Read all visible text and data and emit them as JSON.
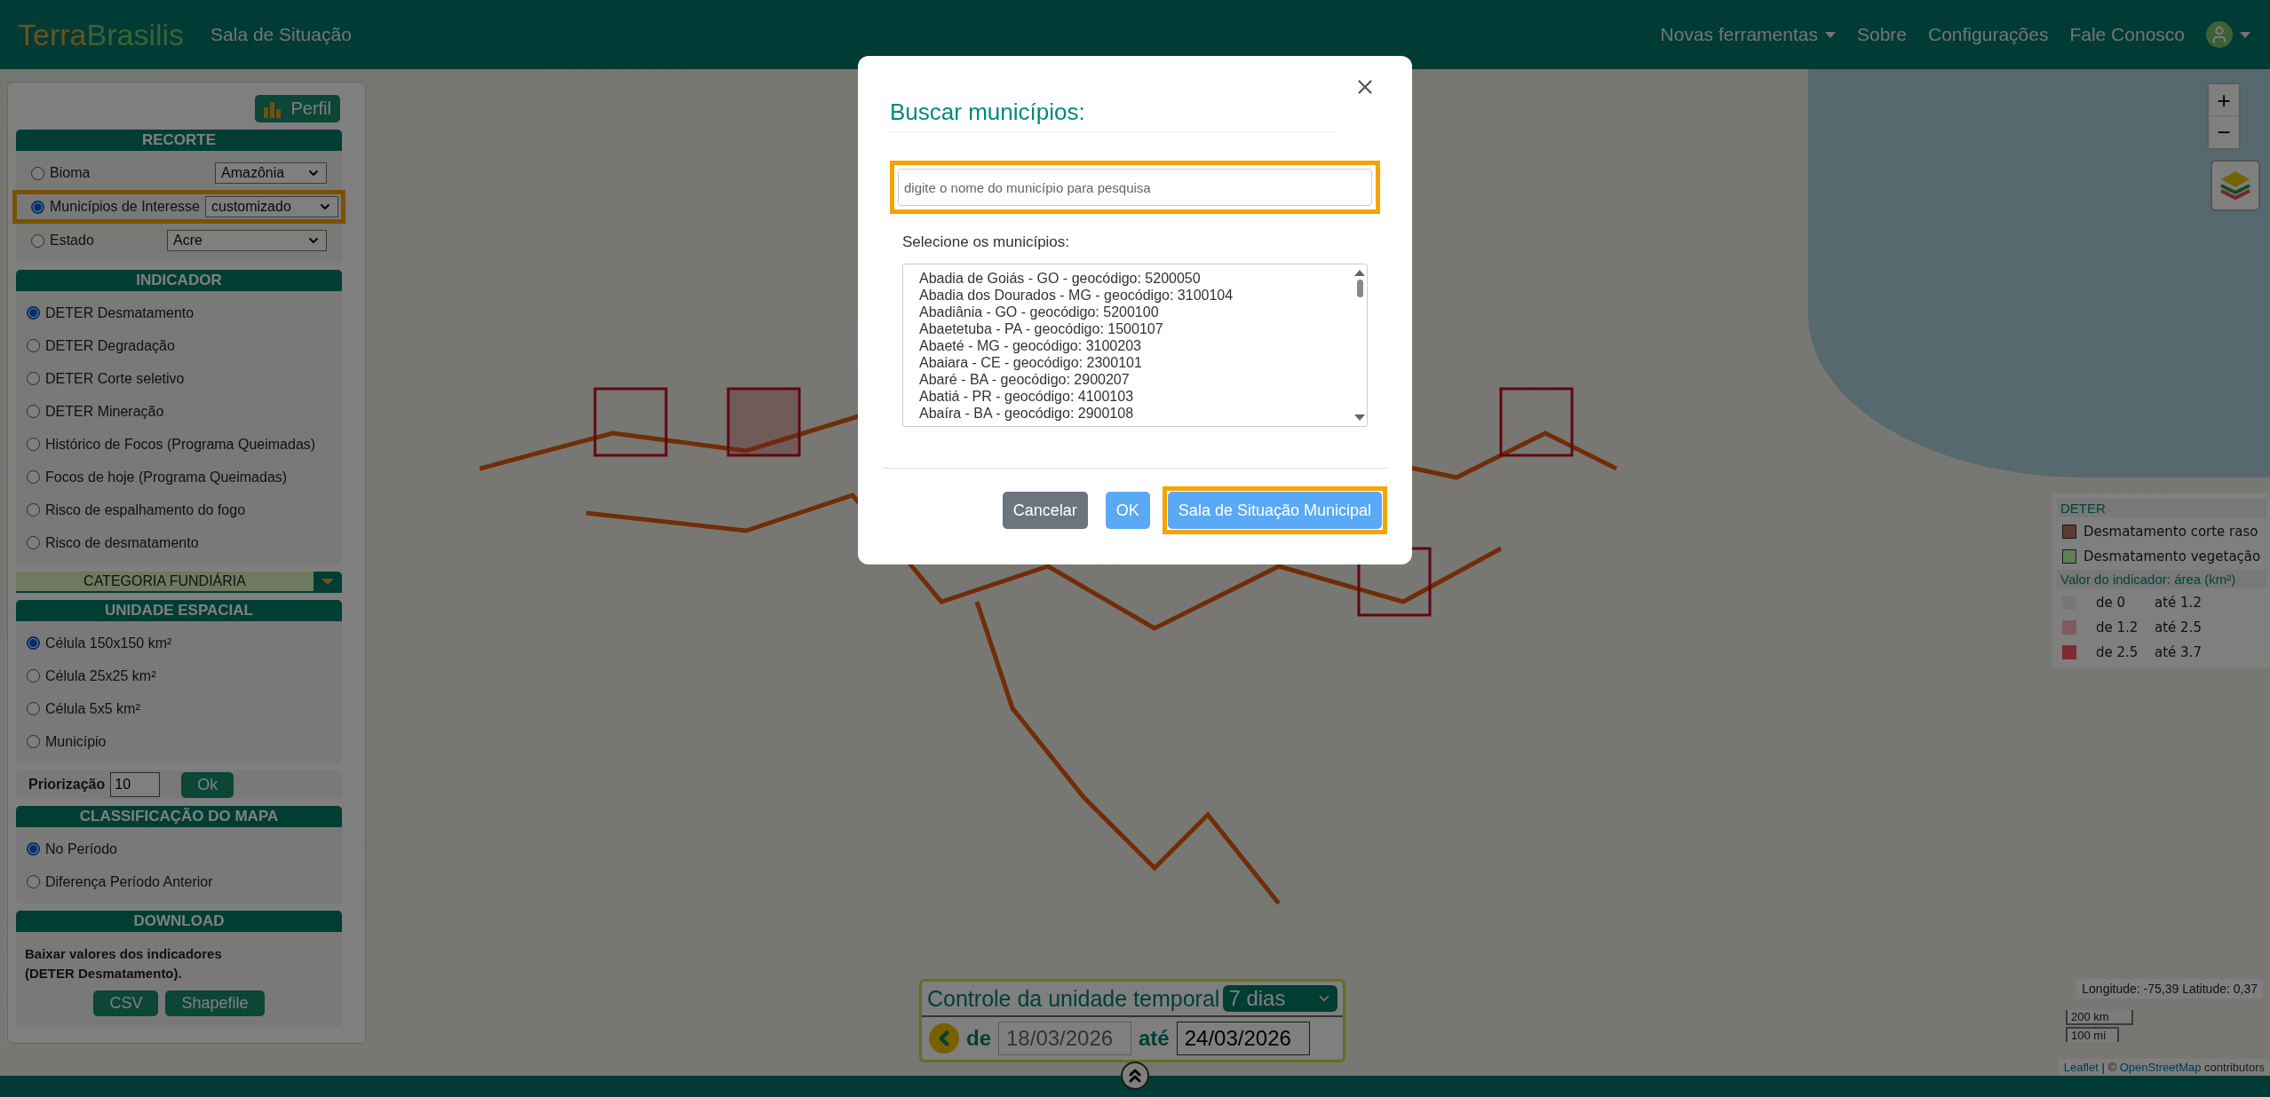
{
  "navbar": {
    "brand": {
      "first": "Terra",
      "second": "Brasilis"
    },
    "subtitle": "Sala de Situação",
    "links": [
      {
        "label": "Novas ferramentas",
        "has_caret": true
      },
      {
        "label": "Sobre",
        "has_caret": false
      },
      {
        "label": "Configurações",
        "has_caret": false
      },
      {
        "label": "Fale Conosco",
        "has_caret": false
      }
    ],
    "user_menu": {
      "has_caret": true
    }
  },
  "panel": {
    "profile_button": "Perfil",
    "sections": [
      {
        "kind": "selects",
        "title": "RECORTE",
        "rows": [
          {
            "label": "Bioma",
            "value": "Amazônia",
            "selected": false,
            "highlighted": false
          },
          {
            "label": "Municípios de Interesse",
            "value": "customizado",
            "selected": true,
            "highlighted": true
          },
          {
            "label": "Estado",
            "value": "Acre",
            "selected": false,
            "highlighted": false
          }
        ]
      },
      {
        "kind": "radios",
        "title": "INDICADOR",
        "options": [
          {
            "label": "DETER Desmatamento",
            "selected": true
          },
          {
            "label": "DETER Degradação",
            "selected": false
          },
          {
            "label": "DETER Corte seletivo",
            "selected": false
          },
          {
            "label": "DETER Mineração",
            "selected": false
          },
          {
            "label": "Histórico de Focos (Programa Queimadas)",
            "selected": false
          },
          {
            "label": "Focos de hoje (Programa Queimadas)",
            "selected": false
          },
          {
            "label": "Risco de espalhamento do fogo",
            "selected": false
          },
          {
            "label": "Risco de desmatamento",
            "selected": false
          }
        ]
      },
      {
        "kind": "collapsible",
        "title": "CATEGORIA FUNDIÁRIA",
        "expanded": false
      },
      {
        "kind": "radios",
        "title": "UNIDADE ESPACIAL",
        "options": [
          {
            "label": "Célula 150x150 km²",
            "selected": true
          },
          {
            "label": "Célula 25x25 km²",
            "selected": false
          },
          {
            "label": "Célula 5x5 km²",
            "selected": false
          },
          {
            "label": "Município",
            "selected": false
          }
        ]
      },
      {
        "kind": "input",
        "label": "Priorização",
        "value": "10",
        "button": "Ok"
      },
      {
        "kind": "radios",
        "title": "CLASSIFICAÇÃO DO MAPA",
        "options": [
          {
            "label": "No Período",
            "selected": true
          },
          {
            "label": "Diferença Período Anterior",
            "selected": false
          }
        ]
      },
      {
        "kind": "download",
        "title": "DOWNLOAD",
        "text": "Baixar valores dos indicadores\n(DETER Desmatamento).",
        "buttons": [
          "CSV",
          "Shapefile"
        ]
      }
    ]
  },
  "map": {
    "zoom_in": "+",
    "zoom_out": "−",
    "legend": {
      "title": "DETER",
      "classes": [
        {
          "label": "Desmatamento corte raso",
          "color": "#5b3b2e"
        },
        {
          "label": "Desmatamento vegetação",
          "color": "#5f7f58"
        }
      ],
      "subtitle": "Valor do indicador: área (km²)",
      "ranges": [
        {
          "from": "de 0",
          "to": "até 1.2",
          "color": "#767676"
        },
        {
          "from": "de 1.2",
          "to": "até 2.5",
          "color": "#7f5a5f"
        },
        {
          "from": "de 2.5",
          "to": "até 3.7",
          "color": "#7f2a30"
        }
      ]
    },
    "coordinates": "Longitude: -75,39 Latitude: 0,37",
    "scale": {
      "metric": "200 km",
      "imperial": "100 mi"
    },
    "attribution": {
      "leaflet": "Leaflet",
      "separator": "| ©",
      "osm": "OpenStreetMap",
      "suffix": "contributors"
    }
  },
  "time_control": {
    "title": "Controle da unidade temporal",
    "period": "7 dias",
    "from_label": "de",
    "from": "18/03/2026",
    "to_label": "até",
    "to": "24/03/2026"
  },
  "modal": {
    "title": "Buscar municípios:",
    "search": {
      "placeholder": "digite o nome do município para pesquisa",
      "highlighted": true
    },
    "list_label": "Selecione os municípios:",
    "municipalities": [
      "Abadia de Goiás - GO - geocódigo: 5200050",
      "Abadia dos Dourados - MG - geocódigo: 3100104",
      "Abadiânia - GO - geocódigo: 5200100",
      "Abaetetuba - PA - geocódigo: 1500107",
      "Abaeté - MG - geocódigo: 3100203",
      "Abaiara - CE - geocódigo: 2300101",
      "Abaré - BA - geocódigo: 2900207",
      "Abatiá - PR - geocódigo: 4100103",
      "Abaíra - BA - geocódigo: 2900108"
    ],
    "buttons": [
      {
        "label": "Cancelar",
        "kind": "secondary",
        "highlighted": false
      },
      {
        "label": "OK",
        "kind": "primary",
        "highlighted": false
      },
      {
        "label": "Sala de Situação Municipal",
        "kind": "primary",
        "highlighted": true
      }
    ]
  }
}
